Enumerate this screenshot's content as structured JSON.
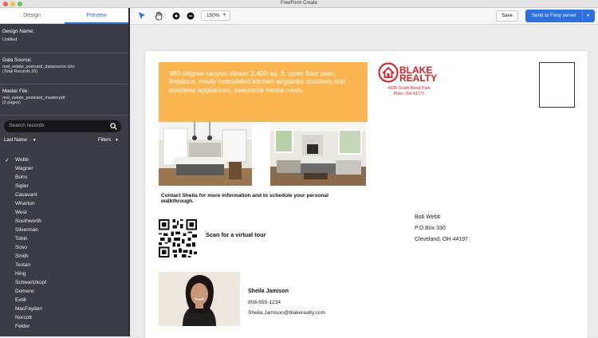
{
  "app": {
    "title": "FreeForm Create"
  },
  "sidebar": {
    "tabs": [
      {
        "label": "Design"
      },
      {
        "label": "Preview"
      }
    ],
    "design_name_label": "Design Name:",
    "design_name_value": "Untitled",
    "data_source_label": "Data Source:",
    "data_source_value": "real_estate_postcard_datasource.xlsx",
    "data_source_records": "(Total Records 20)",
    "master_file_label": "Master File:",
    "master_file_value": "real_estate_postcard_master.pdf",
    "master_file_pages": "(2 pages)",
    "search_placeholder": "Search records",
    "sort_label": "Last Name",
    "filters_label": "Filters",
    "records": [
      "Webb",
      "Wagner",
      "Bohn",
      "Sigler",
      "Casavant",
      "Wharton",
      "West",
      "Southworth",
      "Silverman",
      "Tobin",
      "Soso",
      "Smith",
      "Testan",
      "Hing",
      "Schwartzkopf",
      "Domenc",
      "Extill",
      "MacFayden",
      "Norcott",
      "Felder"
    ],
    "selected_record": "Webb"
  },
  "toolbar": {
    "zoom_value": "150%",
    "save_label": "Save",
    "send_label": "Send to Fiery server"
  },
  "postcard": {
    "headline": "360 degree canyon views! 3,400 sq. ft. open floor plan, fireplace, newly remodeled kitchen w/granite counters and stainless appliances, awesome media room.",
    "brand_name": "BLAKE",
    "brand_name2": "REALTY",
    "brand_address_1": "4435 South Bend Park",
    "brand_address_2": "Philo, OH 43771",
    "contact_text": "Contact Sheila for more information and to schedule your personal walkthrough.",
    "scan_text": "Scan for a virtual tour",
    "recipient_name": "Bob Webb",
    "recipient_street": "P.O.Box 330",
    "recipient_city": "Cleveland, OH 44197",
    "agent_name": "Sheila Jamison",
    "agent_phone": "808-555-1234",
    "agent_email": "Sheila.Jamison@blakerealty.com"
  },
  "colors": {
    "accent": "#2d6fdc",
    "sidebar_bg": "#3a3d47",
    "headline_bg": "#fbb550",
    "brand_red": "#d32027"
  },
  "icons": [
    "select-arrow-icon",
    "hand-pan-icon",
    "zoom-in-icon",
    "zoom-out-icon",
    "search-icon",
    "chevron-down-icon",
    "checkmark-icon",
    "house-logo-icon"
  ]
}
